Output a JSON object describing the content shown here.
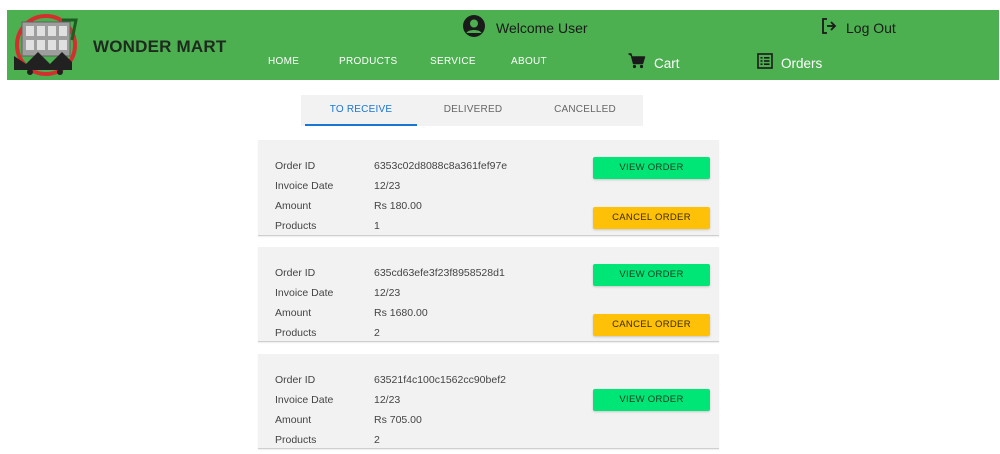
{
  "header": {
    "brand": "WONDER MART",
    "welcome_text": "Welcome User",
    "logout_label": "Log Out",
    "nav": [
      {
        "label": "HOME"
      },
      {
        "label": "PRODUCTS"
      },
      {
        "label": "SERVICE"
      },
      {
        "label": "ABOUT"
      }
    ],
    "cart_label": "Cart",
    "orders_label": "Orders"
  },
  "tabs": [
    {
      "label": "TO RECEIVE",
      "active": true
    },
    {
      "label": "DELIVERED",
      "active": false
    },
    {
      "label": "CANCELLED",
      "active": false
    }
  ],
  "field_labels": {
    "order_id": "Order ID",
    "invoice_date": "Invoice Date",
    "amount": "Amount",
    "products": "Products"
  },
  "button_labels": {
    "view": "VIEW ORDER",
    "cancel": "CANCEL ORDER"
  },
  "orders": [
    {
      "order_id": "6353c02d8088c8a361fef97e",
      "invoice_date": "12/23",
      "amount": "Rs 180.00",
      "products": "1",
      "show_cancel": true
    },
    {
      "order_id": "635cd63efe3f23f8958528d1",
      "invoice_date": "12/23",
      "amount": "Rs 1680.00",
      "products": "2",
      "show_cancel": true
    },
    {
      "order_id": "63521f4c100c1562cc90bef2",
      "invoice_date": "12/23",
      "amount": "Rs 705.00",
      "products": "2",
      "show_cancel": false
    }
  ],
  "colors": {
    "header": "#4caf50",
    "view_button": "#00e676",
    "cancel_button": "#ffc107",
    "active_tab": "#1976d2"
  }
}
